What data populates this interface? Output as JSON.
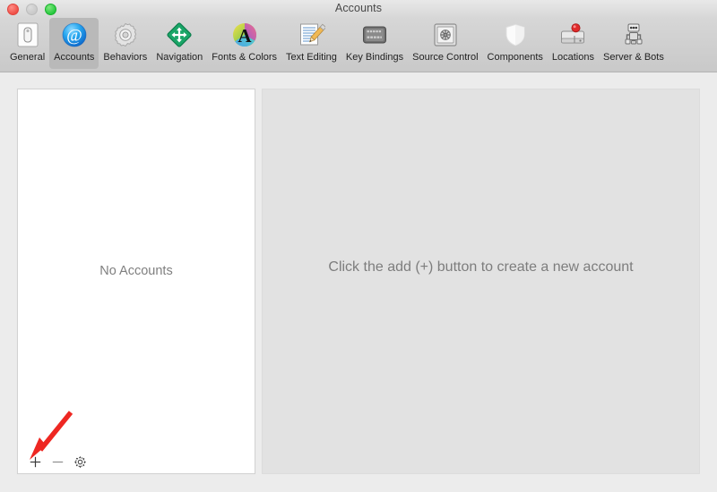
{
  "window": {
    "title": "Accounts",
    "traffic_lights": [
      {
        "name": "close",
        "color": "#ef5048"
      },
      {
        "name": "minimize",
        "color": "#c9c9c9"
      },
      {
        "name": "zoom",
        "color": "#28c940"
      }
    ]
  },
  "toolbar": {
    "selected": "Accounts",
    "items": [
      {
        "label": "General",
        "icon": "general-icon"
      },
      {
        "label": "Accounts",
        "icon": "accounts-at-icon"
      },
      {
        "label": "Behaviors",
        "icon": "gear-icon"
      },
      {
        "label": "Navigation",
        "icon": "move-arrows-diamond-icon"
      },
      {
        "label": "Fonts & Colors",
        "icon": "color-wheel-letter-a-icon"
      },
      {
        "label": "Text Editing",
        "icon": "pencil-document-icon"
      },
      {
        "label": "Key Bindings",
        "icon": "keyboard-icon"
      },
      {
        "label": "Source Control",
        "icon": "safe-vault-icon"
      },
      {
        "label": "Components",
        "icon": "shield-icon"
      },
      {
        "label": "Locations",
        "icon": "drive-pin-icon"
      },
      {
        "label": "Server & Bots",
        "icon": "robot-icon"
      }
    ]
  },
  "accounts_list": {
    "empty_message": "No Accounts",
    "footer": {
      "add_label": "+",
      "remove_label": "−",
      "settings_icon": "gear-icon"
    }
  },
  "detail": {
    "message": "Click the add (+) button to create a new account"
  },
  "annotation": {
    "arrow_color": "#ee2722",
    "arrow_target": "add-account-button"
  }
}
